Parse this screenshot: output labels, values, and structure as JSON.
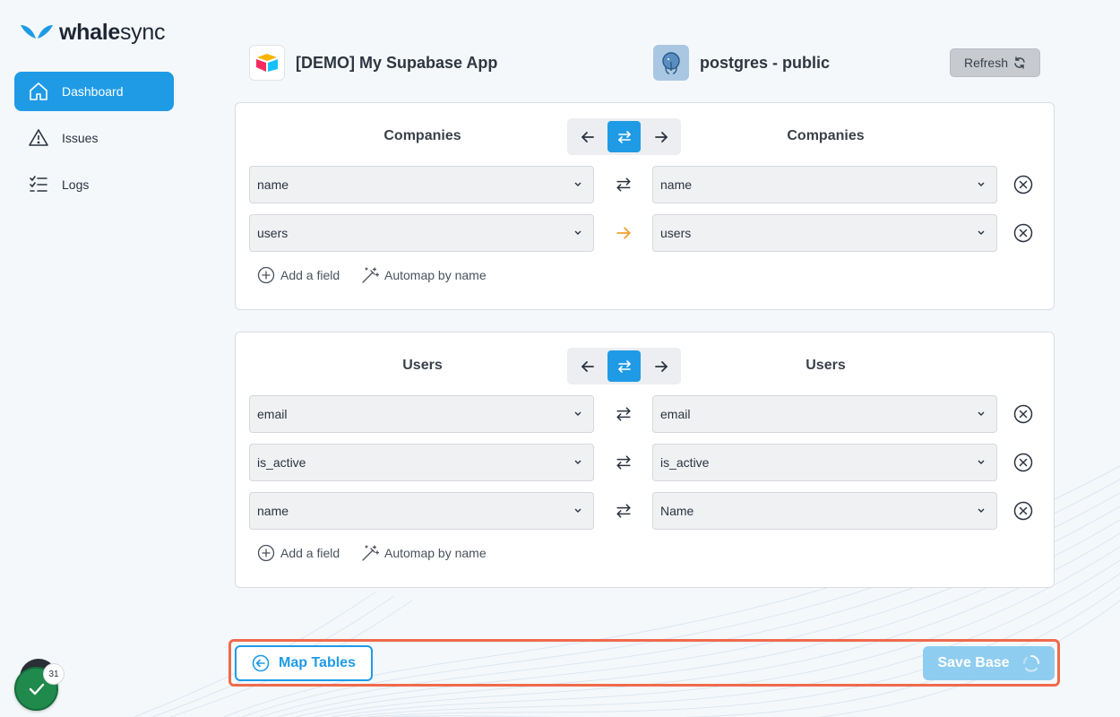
{
  "brand": {
    "name_bold": "whale",
    "name_rest": "sync",
    "accent": "#1f9be6"
  },
  "sidebar": {
    "items": [
      {
        "label": "Dashboard",
        "icon": "home-icon",
        "active": true
      },
      {
        "label": "Issues",
        "icon": "warning-icon"
      },
      {
        "label": "Logs",
        "icon": "list-check-icon"
      }
    ]
  },
  "header": {
    "left_app": {
      "name": "[DEMO] My Supabase App",
      "icon": "airtable-logo-icon"
    },
    "right_app": {
      "name": "postgres - public",
      "icon": "postgres-elephant-icon"
    },
    "refresh_label": "Refresh"
  },
  "mappings": [
    {
      "left_table": "Companies",
      "right_table": "Companies",
      "direction": "two-way",
      "fields": [
        {
          "left": "name",
          "right": "name",
          "sync": "two-way"
        },
        {
          "left": "users",
          "right": "users",
          "sync": "one-way"
        }
      ],
      "add_field_label": "Add a field",
      "automap_label": "Automap by name"
    },
    {
      "left_table": "Users",
      "right_table": "Users",
      "direction": "two-way",
      "fields": [
        {
          "left": "email",
          "right": "email",
          "sync": "two-way"
        },
        {
          "left": "is_active",
          "right": "is_active",
          "sync": "two-way"
        },
        {
          "left": "name",
          "right": "Name",
          "sync": "two-way"
        }
      ],
      "add_field_label": "Add a field",
      "automap_label": "Automap by name"
    }
  ],
  "footer": {
    "map_tables_label": "Map Tables",
    "save_base_label": "Save Base"
  },
  "notifications": {
    "count": "31"
  },
  "colors": {
    "primary": "#1f9be6",
    "one_way_arrow": "#f0a030",
    "highlight_border": "#ef6a4c",
    "success": "#1f8a4c"
  }
}
